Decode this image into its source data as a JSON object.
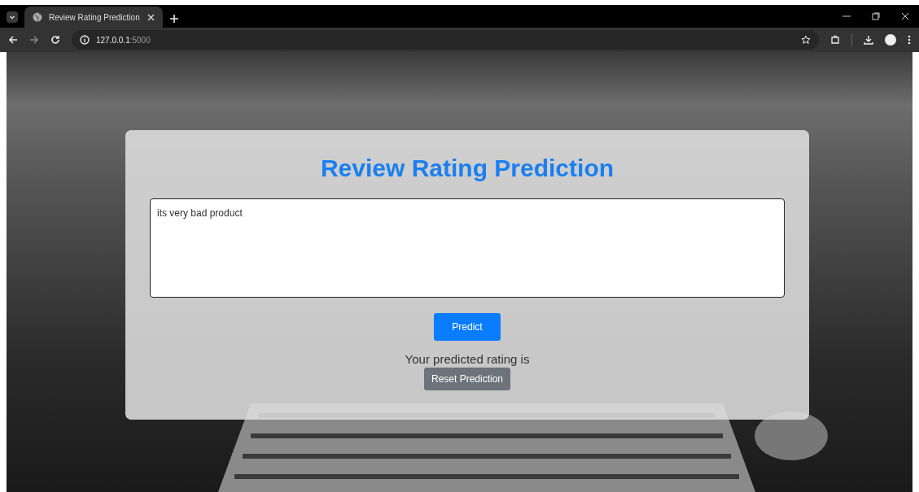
{
  "browser": {
    "tabs": [
      {
        "title": "Review Rating Prediction",
        "selected": true
      }
    ],
    "url_host": "127.0.0.1",
    "url_port": ":5000"
  },
  "page": {
    "title": "Review Rating Prediction",
    "review": {
      "value": "its very bad product"
    },
    "predict_button": "Predict",
    "result_text": "Your predicted rating is",
    "reset_button": "Reset Prediction"
  }
}
